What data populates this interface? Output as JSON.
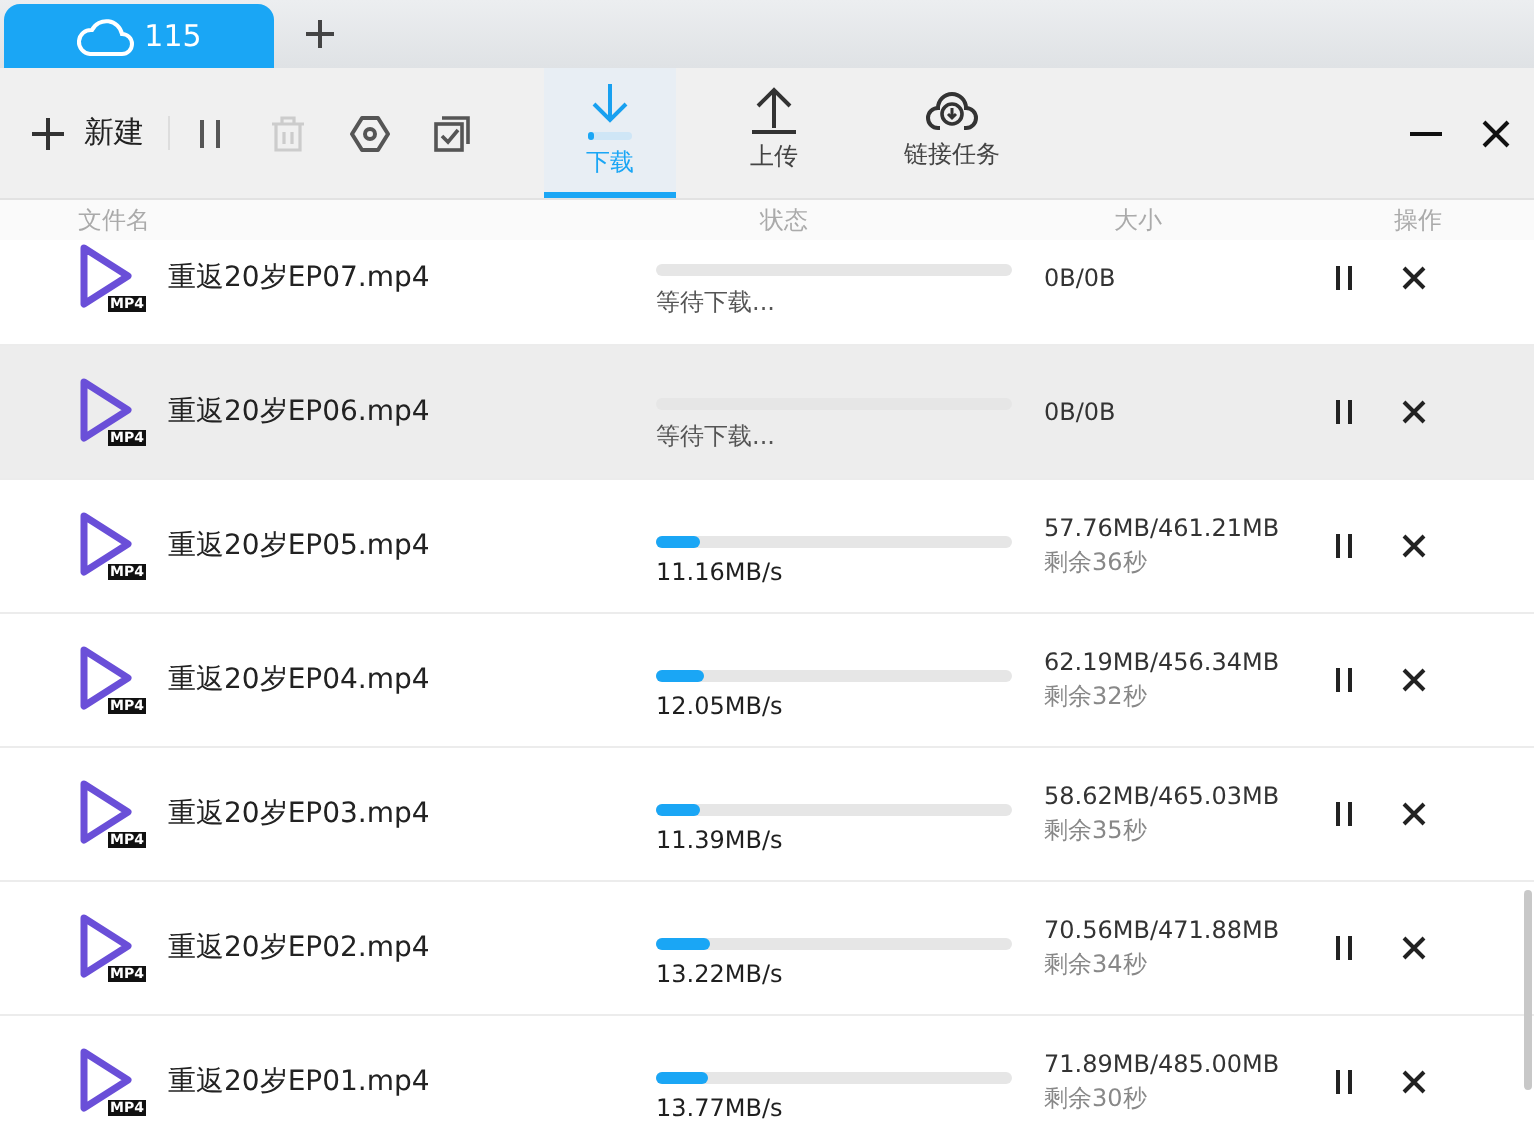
{
  "tabs": [
    {
      "label": "115",
      "selected": true
    }
  ],
  "toolbar": {
    "new_label": "新建",
    "delete_disabled": true
  },
  "modes": [
    {
      "kind": "download",
      "label": "下载",
      "selected": true,
      "level": 0.1
    },
    {
      "kind": "upload",
      "label": "上传",
      "selected": false
    },
    {
      "kind": "link",
      "label": "链接任务",
      "selected": false
    }
  ],
  "columns": [
    "文件名",
    "状态",
    "大小",
    "操作"
  ],
  "rows": [
    {
      "name": "重返20岁EP07.mp4",
      "badge": "MP4",
      "kind": "waiting",
      "status": "等待下载...",
      "size": "0B/0B",
      "highlighted": false
    },
    {
      "name": "重返20岁EP06.mp4",
      "badge": "MP4",
      "kind": "waiting",
      "status": "等待下载...",
      "size": "0B/0B",
      "highlighted": true
    },
    {
      "name": "重返20岁EP05.mp4",
      "badge": "MP4",
      "kind": "active",
      "level": 0.125,
      "status": "11.16MB/s",
      "size": "57.76MB/461.21MB",
      "remaining": "剩余36秒",
      "highlighted": false
    },
    {
      "name": "重返20岁EP04.mp4",
      "badge": "MP4",
      "kind": "active",
      "level": 0.136,
      "status": "12.05MB/s",
      "size": "62.19MB/456.34MB",
      "remaining": "剩余32秒",
      "highlighted": false
    },
    {
      "name": "重返20岁EP03.mp4",
      "badge": "MP4",
      "kind": "active",
      "level": 0.126,
      "status": "11.39MB/s",
      "size": "58.62MB/465.03MB",
      "remaining": "剩余35秒",
      "highlighted": false
    },
    {
      "name": "重返20岁EP02.mp4",
      "badge": "MP4",
      "kind": "active",
      "level": 0.15,
      "status": "13.22MB/s",
      "size": "70.56MB/471.88MB",
      "remaining": "剩余34秒",
      "highlighted": false
    },
    {
      "name": "重返20岁EP01.mp4",
      "badge": "MP4",
      "kind": "active",
      "level": 0.148,
      "status": "13.77MB/s",
      "size": "71.89MB/485.00MB",
      "remaining": "剩余30秒",
      "highlighted": false
    }
  ]
}
